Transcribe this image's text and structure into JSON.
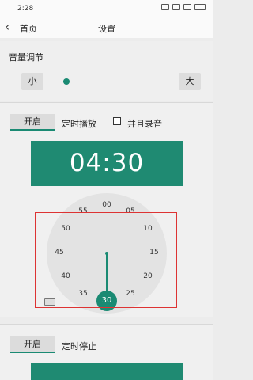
{
  "status": {
    "time": "2:28"
  },
  "nav": {
    "back_icon": "chevron-left-icon",
    "home_label": "首页",
    "title": "设置"
  },
  "volume": {
    "title": "音量调节",
    "small_label": "小",
    "large_label": "大",
    "level": 0.03
  },
  "start_timer": {
    "open_label": "开启",
    "label": "定时播放",
    "checkbox_label": "并且录音",
    "checked": false,
    "time": "04:30"
  },
  "clock": {
    "ticks": [
      "00",
      "05",
      "10",
      "15",
      "20",
      "25",
      "30",
      "35",
      "40",
      "45",
      "50",
      "55"
    ],
    "selected": "30",
    "accent": "#1a8a73"
  },
  "stop_timer": {
    "open_label": "开启",
    "label": "定时停止"
  }
}
